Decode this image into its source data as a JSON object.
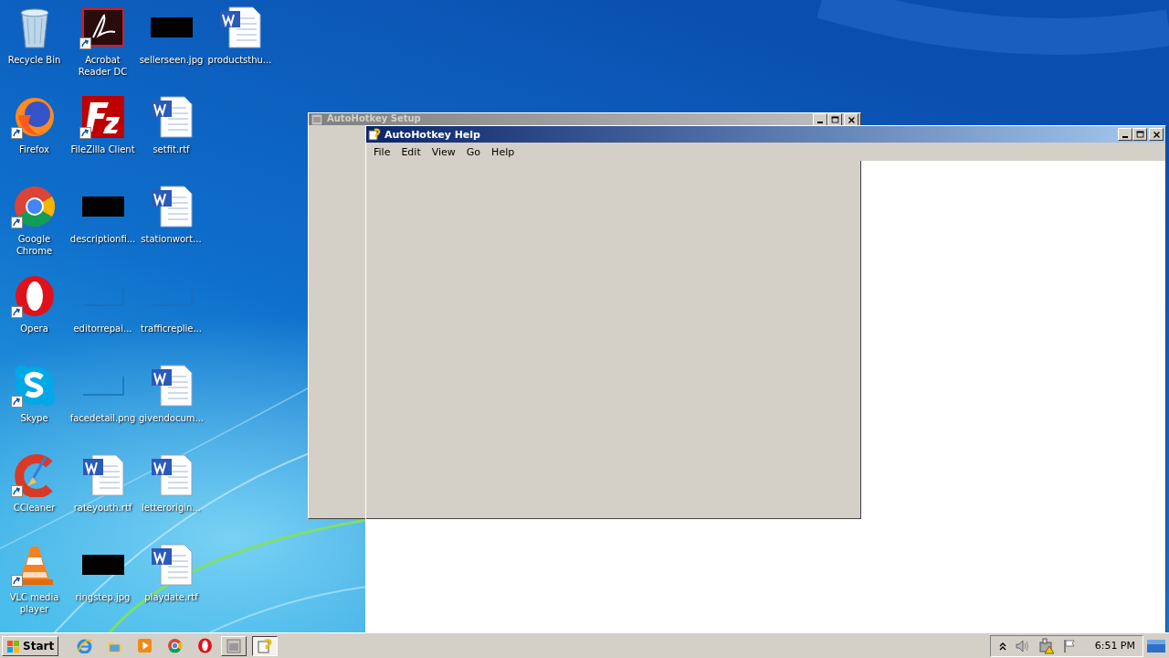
{
  "desktop_icons": [
    {
      "label": "Recycle Bin",
      "kind": "recycle",
      "shortcut": false
    },
    {
      "label": "Firefox",
      "kind": "firefox",
      "shortcut": true
    },
    {
      "label": "Google Chrome",
      "kind": "chrome",
      "shortcut": true
    },
    {
      "label": "Opera",
      "kind": "opera",
      "shortcut": true
    },
    {
      "label": "Skype",
      "kind": "skype",
      "shortcut": true
    },
    {
      "label": "CCleaner",
      "kind": "ccleaner",
      "shortcut": true
    },
    {
      "label": "VLC media player",
      "kind": "vlc",
      "shortcut": true
    },
    {
      "label": "Acrobat Reader DC",
      "kind": "acrobat",
      "shortcut": true
    },
    {
      "label": "FileZilla Client",
      "kind": "filezilla",
      "shortcut": true
    },
    {
      "label": "descriptionfi...",
      "kind": "dark-image",
      "shortcut": false
    },
    {
      "label": "editorrepai...",
      "kind": "blank-image",
      "shortcut": false
    },
    {
      "label": "facedetail.png",
      "kind": "blank-image",
      "shortcut": false
    },
    {
      "label": "rateyouth.rtf",
      "kind": "word",
      "shortcut": false
    },
    {
      "label": "ringstep.jpg",
      "kind": "dark-image",
      "shortcut": false
    },
    {
      "label": "sellerseen.jpg",
      "kind": "dark-image",
      "shortcut": false
    },
    {
      "label": "setfit.rtf",
      "kind": "word",
      "shortcut": false
    },
    {
      "label": "stationwort...",
      "kind": "word",
      "shortcut": false
    },
    {
      "label": "trafficreplie...",
      "kind": "blank-image",
      "shortcut": false
    },
    {
      "label": "givendocum...",
      "kind": "word",
      "shortcut": false
    },
    {
      "label": "letterorigin...",
      "kind": "word",
      "shortcut": false
    },
    {
      "label": "playdate.rtf",
      "kind": "word",
      "shortcut": false
    },
    {
      "label": "productsthu...",
      "kind": "word",
      "shortcut": false
    }
  ],
  "windows": [
    {
      "title": "AutoHotkey Setup",
      "active": false
    },
    {
      "title": "AutoHotkey Help",
      "active": true,
      "menu": [
        "File",
        "Edit",
        "View",
        "Go",
        "Help"
      ]
    }
  ],
  "taskbar": {
    "start": "Start",
    "quick_launch": [
      {
        "kind": "ie"
      },
      {
        "kind": "folder"
      },
      {
        "kind": "media"
      },
      {
        "kind": "chrome"
      },
      {
        "kind": "opera"
      }
    ],
    "tasks": [
      {
        "kind": "setup",
        "selected": false
      },
      {
        "kind": "help",
        "selected": true
      }
    ],
    "tray": {
      "time": "6:51 PM"
    }
  }
}
